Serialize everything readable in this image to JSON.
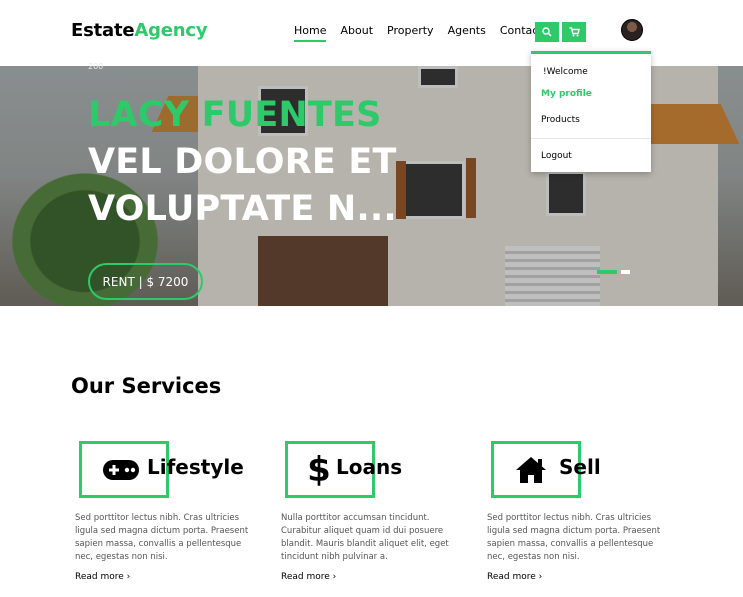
{
  "brand": {
    "part1": "Estate",
    "part2": "Agency"
  },
  "nav": [
    {
      "label": "Home",
      "active": true
    },
    {
      "label": "About",
      "active": false
    },
    {
      "label": "Property",
      "active": false
    },
    {
      "label": "Agents",
      "active": false
    },
    {
      "label": "Contact",
      "active": false
    }
  ],
  "icons": {
    "search": "search-icon",
    "cart": "cart-icon"
  },
  "dropdown": {
    "welcome": "!Welcome",
    "my_profile": "My profile",
    "products": "Products",
    "logout": "Logout"
  },
  "hero": {
    "small_number": "200",
    "title_line1": "LACY FUENTES",
    "title_line2": "VEL DOLORE ET",
    "title_line3": "VOLUPTATE N...",
    "rent": "RENT | $ 7200",
    "slides": 2,
    "active_slide": 1
  },
  "services": {
    "heading": "Our Services",
    "cards": [
      {
        "title": "Lifestyle",
        "icon": "gamepad-icon",
        "text": "Sed porttitor lectus nibh. Cras ultricies ligula sed magna dictum porta. Praesent sapien massa, convallis a pellentesque nec, egestas non nisi.",
        "link": "Read more"
      },
      {
        "title": "Loans",
        "icon": "dollar-icon",
        "text": "Nulla porttitor accumsan tincidunt. Curabitur aliquet quam id dui posuere blandit. Mauris blandit aliquet elit, eget tincidunt nibh pulvinar a.",
        "link": "Read more"
      },
      {
        "title": "Sell",
        "icon": "home-icon",
        "text": "Sed porttitor lectus nibh. Cras ultricies ligula sed magna dictum porta. Praesent sapien massa, convallis a pellentesque nec, egestas non nisi.",
        "link": "Read more"
      }
    ]
  },
  "colors": {
    "accent": "#2eca6a",
    "text": "#000000",
    "muted": "#555555"
  }
}
